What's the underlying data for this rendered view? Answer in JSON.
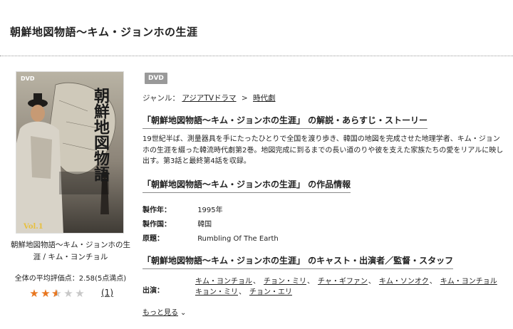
{
  "page": {
    "title": "朝鮮地図物語〜キム・ジョンホの生涯"
  },
  "cover": {
    "caption": "朝鮮地図物語〜キム・ジョンホの生涯 / キム・ヨンチョル",
    "dvd_logo": "DVD",
    "art_title": "朝鮮地図物語",
    "art_vol": "Vol.1"
  },
  "rating": {
    "text": "全体の平均評価点：2.58(5点満点)",
    "score": 2.58,
    "max": 5,
    "review_count": "(1)"
  },
  "badge": "DVD",
  "genre": {
    "label": "ジャンル：",
    "crumbs": [
      "アジアTVドラマ",
      "時代劇"
    ],
    "separator": ">"
  },
  "synopsis": {
    "heading": "「朝鮮地図物語〜キム・ジョンホの生涯」 の解説・あらすじ・ストーリー",
    "text": "19世紀半ば、測量器具を手にたったひとりで全国を渡り歩き、韓国の地図を完成させた地理学者、キム・ジョンホの生涯を綴った韓流時代劇第2巻。地図完成に到るまでの長い道のりや彼を支えた家族たちの愛をリアルに映し出す。第3話と最終第4話を収録。"
  },
  "info": {
    "heading": "「朝鮮地図物語〜キム・ジョンホの生涯」 の作品情報",
    "rows": [
      {
        "label": "製作年：",
        "value": "1995年"
      },
      {
        "label": "製作国：",
        "value": "韓国"
      },
      {
        "label": "原題：",
        "value": "Rumbling Of The Earth"
      }
    ]
  },
  "cast": {
    "heading": "「朝鮮地図物語〜キム・ジョンホの生涯」 のキャスト・出演者／監督・スタッフ",
    "label": "出演：",
    "names": [
      "キム・ヨンチョル",
      "チョン・ミリ",
      "チャ・ギファン",
      "キム・ソンオク",
      "キム・ヨンチョル",
      "キョン・ミリ",
      "チョン・エリ"
    ],
    "more": "もっと見る"
  },
  "colors": {
    "star_filled": "#e8761e",
    "star_empty": "#c8c8c8",
    "badge_bg": "#999999"
  }
}
